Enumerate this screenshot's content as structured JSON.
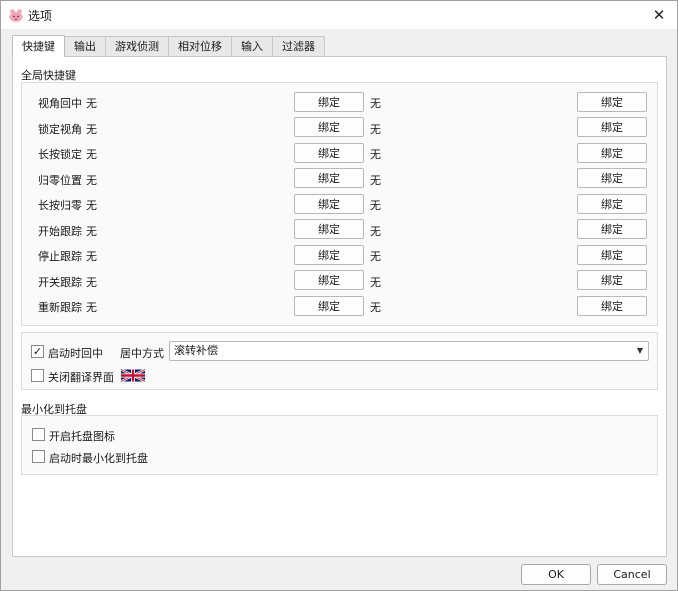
{
  "window": {
    "title": "选项"
  },
  "tabs": [
    {
      "label": "快捷键",
      "active": true
    },
    {
      "label": "输出"
    },
    {
      "label": "游戏侦测"
    },
    {
      "label": "相对位移"
    },
    {
      "label": "输入"
    },
    {
      "label": "过滤器"
    }
  ],
  "hotkeys": {
    "section_title": "全局快捷键",
    "bind_label": "绑定",
    "rows": [
      {
        "label": "视角回中",
        "value1": "无",
        "value2": "无"
      },
      {
        "label": "锁定视角",
        "value1": "无",
        "value2": "无"
      },
      {
        "label": "长按锁定",
        "value1": "无",
        "value2": "无"
      },
      {
        "label": "归零位置",
        "value1": "无",
        "value2": "无"
      },
      {
        "label": "长按归零",
        "value1": "无",
        "value2": "无"
      },
      {
        "label": "开始跟踪",
        "value1": "无",
        "value2": "无"
      },
      {
        "label": "停止跟踪",
        "value1": "无",
        "value2": "无"
      },
      {
        "label": "开关跟踪",
        "value1": "无",
        "value2": "无"
      },
      {
        "label": "重新跟踪",
        "value1": "无",
        "value2": "无"
      }
    ]
  },
  "options": {
    "center_on_start": {
      "label": "启动时回中",
      "checked": true,
      "mark": "✓"
    },
    "center_mode": {
      "label": "居中方式",
      "selected": "滚转补偿"
    },
    "close_translation": {
      "label": "关闭翻译界面",
      "checked": false,
      "flag_icon": "uk-flag-icon"
    }
  },
  "tray": {
    "section_title": "最小化到托盘",
    "enable_tray_icon": {
      "label": "开启托盘图标",
      "checked": false
    },
    "minimize_on_start": {
      "label": "启动时最小化到托盘",
      "checked": false
    }
  },
  "footer": {
    "ok_label": "OK",
    "cancel_label": "Cancel"
  }
}
